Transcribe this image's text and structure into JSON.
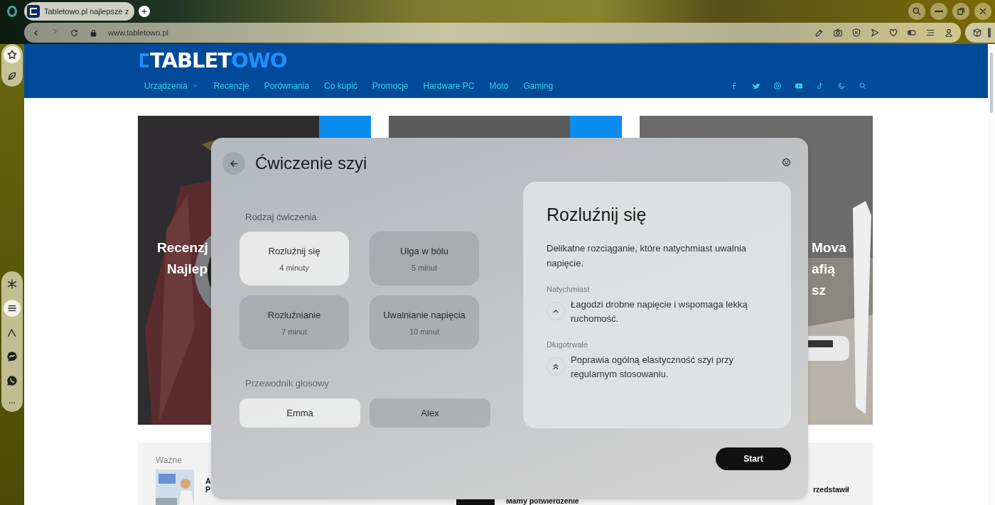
{
  "browser": {
    "tab": {
      "title": "Tabletowo.pl najlepsze z",
      "selected": true
    },
    "url": "www.tabletowo.pl",
    "toolbar_icons": [
      {
        "kind": "edit"
      },
      {
        "kind": "camera"
      },
      {
        "kind": "shield"
      },
      {
        "kind": "send"
      },
      {
        "kind": "heart"
      },
      {
        "kind": "battery"
      },
      {
        "kind": "list"
      },
      {
        "kind": "person"
      }
    ],
    "sidebar_icons": [
      {
        "kind": "asterisk",
        "selected": false
      },
      {
        "kind": "wave",
        "selected": true
      },
      {
        "kind": "peak",
        "selected": false
      },
      {
        "kind": "messenger",
        "selected": false
      },
      {
        "kind": "whatsapp",
        "selected": false
      }
    ],
    "sidebar_more": "..."
  },
  "site": {
    "logo": {
      "text": "TABLET",
      "accent": "OWO"
    },
    "nav": [
      {
        "label": "Urządzenia",
        "has_menu": true
      },
      {
        "label": "Recenzje",
        "has_menu": false
      },
      {
        "label": "Porównania",
        "has_menu": false
      },
      {
        "label": "Co kupić",
        "has_menu": false
      },
      {
        "label": "Promocje",
        "has_menu": false
      },
      {
        "label": "Hardware PC",
        "has_menu": false
      },
      {
        "label": "Moto",
        "has_menu": false
      },
      {
        "label": "Gaming",
        "has_menu": false
      }
    ],
    "social_icons": [
      {
        "kind": "facebook"
      },
      {
        "kind": "twitter"
      },
      {
        "kind": "instagram"
      },
      {
        "kind": "youtube"
      },
      {
        "kind": "tiktok"
      },
      {
        "kind": "moon"
      },
      {
        "kind": "search"
      }
    ],
    "cards": [
      {
        "kind": "phone",
        "badge": true,
        "title_lines": [
          "Recenzj",
          "Najlep"
        ]
      },
      {
        "kind": "plain",
        "badge": true
      },
      {
        "kind": "vacuum",
        "badge": false,
        "title_lines": [
          "Mova",
          "afią",
          "sz"
        ]
      }
    ],
    "bottom": {
      "heading": "Ważne",
      "left_lines": [
        "A",
        "P"
      ],
      "middle_text": "Mamy potwierdzenie",
      "right_text": "rzedstawił"
    }
  },
  "modal": {
    "title": "Ćwiczenie szyi",
    "exercise_label": "Rodzaj ćwiczenia",
    "exercises": [
      {
        "name": "Rozluźnij się",
        "duration": "4 minuty",
        "selected": true
      },
      {
        "name": "Ulga w bólu",
        "duration": "5 minut",
        "selected": false
      },
      {
        "name": "Rozluźnianie",
        "duration": "7 minut",
        "selected": false
      },
      {
        "name": "Uwalnianie napięcia",
        "duration": "10 minut",
        "selected": false
      }
    ],
    "voice_label": "Przewodnik głosowy",
    "voices": [
      {
        "name": "Emma",
        "selected": true
      },
      {
        "name": "Alex",
        "selected": false
      }
    ],
    "detail": {
      "title": "Rozluźnij się",
      "description": "Delikatne rozciąganie, które natychmiast uwalnia napięcie.",
      "sections": [
        {
          "label": "Natychmiast",
          "text": "Łagodzi drobne napięcie i wspomaga lekką ruchomość.",
          "kind": "single"
        },
        {
          "label": "Długotrwale",
          "text": "Poprawia ogólną elastyczność szyi przy regularnym stosowaniu.",
          "kind": "double"
        }
      ]
    },
    "start": "Start"
  }
}
